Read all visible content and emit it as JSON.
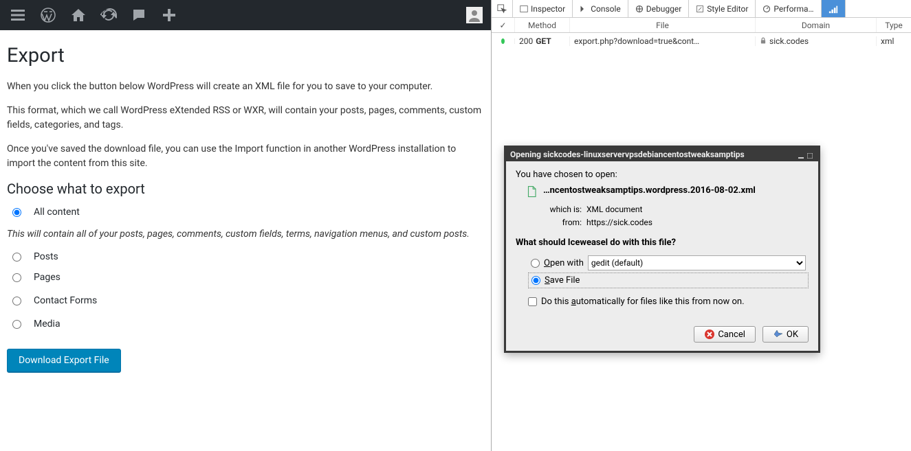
{
  "wp": {
    "page_title": "Export",
    "intro1": "When you click the button below WordPress will create an XML file for you to save to your computer.",
    "intro2": "This format, which we call WordPress eXtended RSS or WXR, will contain your posts, pages, comments, custom fields, categories, and tags.",
    "intro3": "Once you've saved the download file, you can use the Import function in another WordPress installation to import the content from this site.",
    "choose_heading": "Choose what to export",
    "options": [
      {
        "label": "All content",
        "checked": true
      },
      {
        "label": "Posts",
        "checked": false
      },
      {
        "label": "Pages",
        "checked": false
      },
      {
        "label": "Contact Forms",
        "checked": false
      },
      {
        "label": "Media",
        "checked": false
      }
    ],
    "all_content_desc": "This will contain all of your posts, pages, comments, custom fields, terms, navigation menus, and custom posts.",
    "download_button": "Download Export File"
  },
  "devtools": {
    "tabs": {
      "inspector": "Inspector",
      "console": "Console",
      "debugger": "Debugger",
      "style_editor": "Style Editor",
      "performance": "Performa…"
    },
    "net_headers": {
      "check": "✓",
      "method": "Method",
      "file": "File",
      "domain": "Domain",
      "type": "Type"
    },
    "net_row": {
      "status": "200",
      "method": "GET",
      "file": "export.php?download=true&cont…",
      "domain": "sick.codes",
      "type": "xml"
    }
  },
  "dialog": {
    "title": "Opening sickcodes-linuxservervpsdebiancentostweaksamptips",
    "chosen": "You have chosen to open:",
    "filename": "…ncentostweaksamptips.wordpress.2016-08-02.xml",
    "which_is_label": "which is:",
    "which_is_value": "XML document",
    "from_label": "from:",
    "from_value": "https://sick.codes",
    "question": "What should Iceweasel do with this file?",
    "open_with": "Open with",
    "open_with_app": "gedit (default)",
    "save_file": "Save File",
    "auto": "Do this automatically for files like this from now on.",
    "cancel": "Cancel",
    "ok": "OK"
  }
}
